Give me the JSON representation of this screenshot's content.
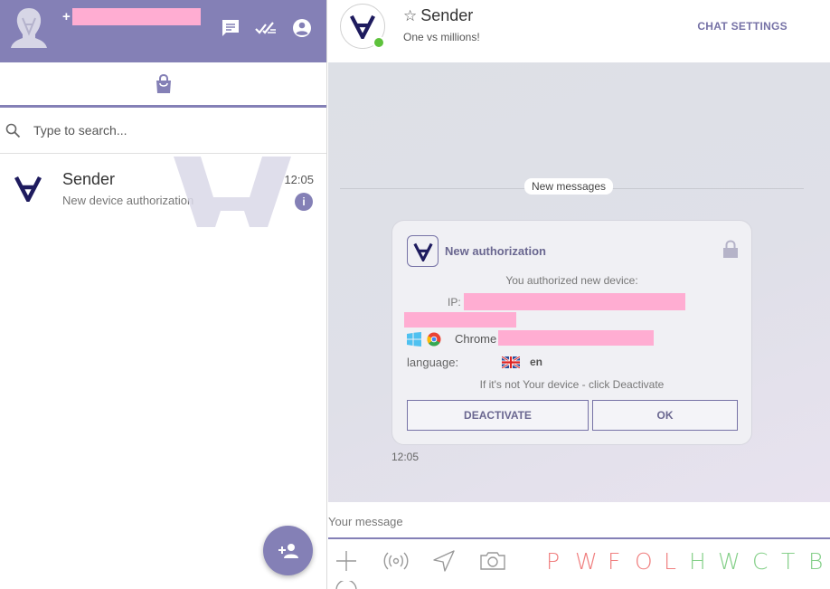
{
  "sidebar": {
    "phone_prefix": "+",
    "search_placeholder": "Type to search...",
    "chats": [
      {
        "name": "Sender",
        "preview": "New device authorization",
        "time": "12:05",
        "info": "i"
      }
    ]
  },
  "conversation": {
    "title": "Sender",
    "star": "☆",
    "subtitle": "One vs millions!",
    "settings_label": "CHAT SETTINGS",
    "divider": "New messages",
    "message": {
      "title": "New authorization",
      "line1": "You authorized new device:",
      "ip_label": "IP:",
      "browser": "Chrome",
      "language_label": "language:",
      "language_value": "en",
      "warning": "If it's not Your device - click Deactivate",
      "deactivate_label": "DEACTIVATE",
      "ok_label": "OK",
      "time": "12:05"
    },
    "composer_placeholder": "Your message"
  },
  "toolbar": {
    "letters": [
      {
        "char": "P",
        "color": "#f08080"
      },
      {
        "char": "W",
        "color": "#f08080"
      },
      {
        "char": "F",
        "color": "#f08080"
      },
      {
        "char": "O",
        "color": "#f08080"
      },
      {
        "char": "L",
        "color": "#f08080"
      },
      {
        "char": "H",
        "color": "#86d08a"
      },
      {
        "char": "W",
        "color": "#86d08a"
      },
      {
        "char": "C",
        "color": "#86d08a"
      },
      {
        "char": "T",
        "color": "#86d08a"
      },
      {
        "char": "B",
        "color": "#86d08a"
      }
    ]
  },
  "colors": {
    "accent": "#8480b6",
    "online": "#5ec23c",
    "redaction": "#ffadd2"
  }
}
